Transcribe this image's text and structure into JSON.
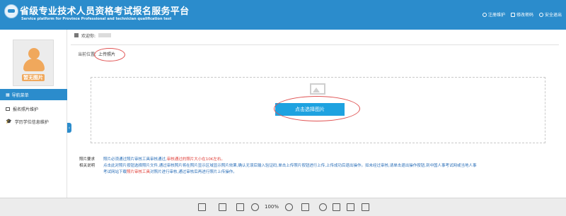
{
  "header": {
    "title": "省级专业技术人员资格考试报名服务平台",
    "subtitle": "Service platform for Province Professional and technician qualification test",
    "links": [
      "注册维护",
      "修改密码",
      "安全退出"
    ]
  },
  "welcome": {
    "label": "欢迎你:"
  },
  "sidebar": {
    "avatar_label": "暂无图片",
    "nav_head": "导航菜单",
    "items": [
      "报名照片维护",
      "学历学位信息维护"
    ]
  },
  "breadcrumb": {
    "prefix": "当前位置:",
    "current": "上传照片"
  },
  "upload": {
    "button": "点击选择图片"
  },
  "notes": {
    "label_1": "照片要求",
    "label_2": "相关说明",
    "line_1a": "照片必须通过照片审核工具审核通过,",
    "line_1b": "审核通过的照片大小在10K左右。",
    "line_2": "点击此对照片按钮选择照片文件,通过审核照片将在照片显示区域显示照片效果,确认无误后输入验证码,单击上传照片按钮进行上传,上传成功后退出操作。如未经过审核,请单击退出操作按钮,到中国人事考试网或当地人事",
    "line_3a": "考试网站下载",
    "line_3b": "照片审核工具",
    "line_3c": "对照片进行审核,通过审核后再进行照片上传操作。"
  },
  "toolbar": {
    "zoom": "100%"
  },
  "colors": {
    "primary": "#2b8ccc",
    "accent_red": "#e0403a",
    "button": "#1ea2e0"
  }
}
